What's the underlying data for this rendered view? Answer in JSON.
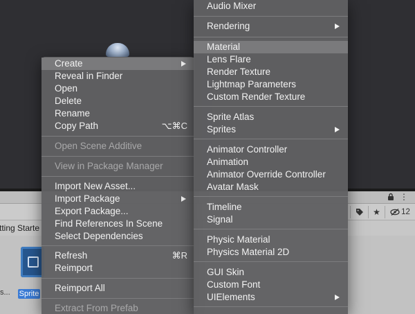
{
  "background": {
    "breadcrumb_fragment": "tting Starte",
    "asset_label": "Sprite",
    "toolbar_hidden_count": "12",
    "dots": "s..."
  },
  "left_menu": {
    "items": [
      {
        "label": "Create",
        "highlighted": true,
        "submenu": true
      },
      {
        "label": "Reveal in Finder"
      },
      {
        "label": "Open"
      },
      {
        "label": "Delete"
      },
      {
        "label": "Rename"
      },
      {
        "label": "Copy Path",
        "shortcut": "⌥⌘C"
      },
      {
        "label": "Open Scene Additive",
        "disabled": true
      },
      {
        "label": "View in Package Manager",
        "disabled": true
      },
      {
        "label": "Import New Asset..."
      },
      {
        "label": "Import Package",
        "submenu": true
      },
      {
        "label": "Export Package..."
      },
      {
        "label": "Find References In Scene"
      },
      {
        "label": "Select Dependencies"
      },
      {
        "label": "Refresh",
        "shortcut": "⌘R"
      },
      {
        "label": "Reimport"
      },
      {
        "label": "Reimport All"
      },
      {
        "label": "Extract From Prefab",
        "disabled": true
      }
    ]
  },
  "right_menu": {
    "items": [
      {
        "label": "Audio Mixer"
      },
      {
        "label": "Rendering",
        "submenu": true
      },
      {
        "label": "Material",
        "highlighted": true
      },
      {
        "label": "Lens Flare"
      },
      {
        "label": "Render Texture"
      },
      {
        "label": "Lightmap Parameters"
      },
      {
        "label": "Custom Render Texture"
      },
      {
        "label": "Sprite Atlas"
      },
      {
        "label": "Sprites",
        "submenu": true
      },
      {
        "label": "Animator Controller"
      },
      {
        "label": "Animation"
      },
      {
        "label": "Animator Override Controller"
      },
      {
        "label": "Avatar Mask"
      },
      {
        "label": "Timeline"
      },
      {
        "label": "Signal"
      },
      {
        "label": "Physic Material"
      },
      {
        "label": "Physics Material 2D"
      },
      {
        "label": "GUI Skin"
      },
      {
        "label": "Custom Font"
      },
      {
        "label": "UIElements",
        "submenu": true
      }
    ]
  }
}
